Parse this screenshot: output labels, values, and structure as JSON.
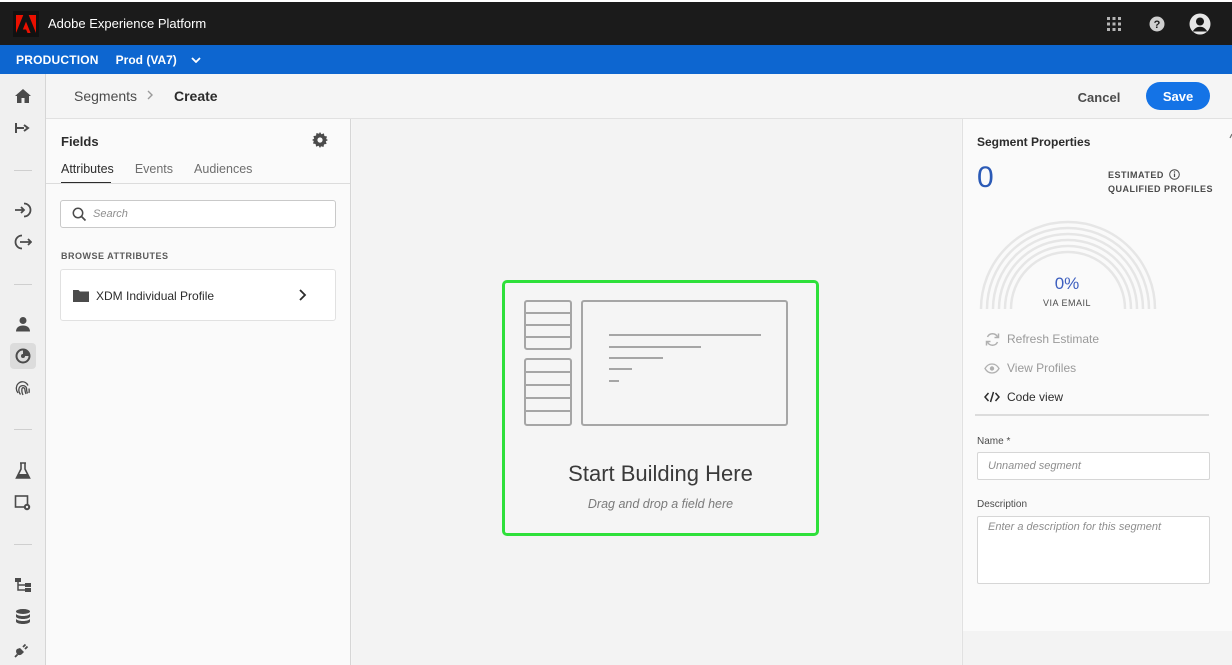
{
  "app": {
    "title": "Adobe Experience Platform",
    "brand_color": "#eb1000"
  },
  "env": {
    "org": "PRODUCTION",
    "sandbox": "Prod (VA7)",
    "bar_color": "#0d66d0"
  },
  "rail": {
    "icons": [
      "home-icon",
      "journey-icon",
      "source-icon",
      "destination-icon",
      "profile-icon",
      "segment-icon",
      "identity-icon",
      "lab-icon",
      "settings-icon",
      "schema-icon",
      "dataset-icon",
      "plug-icon"
    ],
    "active": "segment-icon"
  },
  "header": {
    "breadcrumb_parent": "Segments",
    "breadcrumb_current": "Create",
    "cancel_label": "Cancel",
    "save_label": "Save",
    "save_color": "#1473e6"
  },
  "fields": {
    "title": "Fields",
    "tabs": [
      {
        "label": "Attributes",
        "active": true
      },
      {
        "label": "Events",
        "active": false
      },
      {
        "label": "Audiences",
        "active": false
      }
    ],
    "search_placeholder": "Search",
    "browse_label": "BROWSE ATTRIBUTES",
    "items": [
      {
        "label": "XDM Individual Profile",
        "icon": "folder-icon"
      }
    ]
  },
  "canvas": {
    "title": "Start Building Here",
    "subtitle": "Drag and drop a field here",
    "border_color": "#2ee03a"
  },
  "properties": {
    "title": "Segment Properties",
    "qualified_count": "0",
    "estimated_label_line1": "ESTIMATED",
    "estimated_label_line2": "QUALIFIED PROFILES",
    "gauge_percent": "0%",
    "gauge_fill_fraction": 0,
    "gauge_label": "VIA EMAIL",
    "refresh_label": "Refresh Estimate",
    "view_profiles_label": "View Profiles",
    "code_view_label": "Code view",
    "name_label": "Name *",
    "name_placeholder": "Unnamed segment",
    "description_label": "Description",
    "description_placeholder": "Enter a description for this segment"
  }
}
